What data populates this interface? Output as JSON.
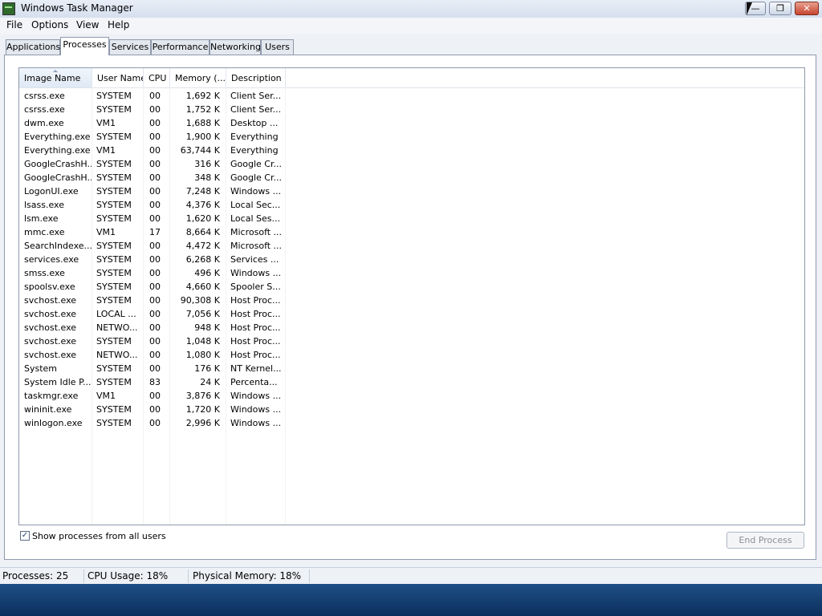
{
  "window": {
    "title": "Windows Task Manager"
  },
  "menu": [
    "File",
    "Options",
    "View",
    "Help"
  ],
  "tabs": [
    "Applications",
    "Processes",
    "Services",
    "Performance",
    "Networking",
    "Users"
  ],
  "active_tab": "Processes",
  "columns": [
    "Image Name",
    "User Name",
    "CPU",
    "Memory (...",
    "Description"
  ],
  "processes": [
    {
      "name": "csrss.exe",
      "user": "SYSTEM",
      "cpu": "00",
      "mem": "1,692 K",
      "desc": "Client Ser..."
    },
    {
      "name": "csrss.exe",
      "user": "SYSTEM",
      "cpu": "00",
      "mem": "1,752 K",
      "desc": "Client Ser..."
    },
    {
      "name": "dwm.exe",
      "user": "VM1",
      "cpu": "00",
      "mem": "1,688 K",
      "desc": "Desktop ..."
    },
    {
      "name": "Everything.exe",
      "user": "SYSTEM",
      "cpu": "00",
      "mem": "1,900 K",
      "desc": "Everything"
    },
    {
      "name": "Everything.exe",
      "user": "VM1",
      "cpu": "00",
      "mem": "63,744 K",
      "desc": "Everything"
    },
    {
      "name": "GoogleCrashH...",
      "user": "SYSTEM",
      "cpu": "00",
      "mem": "316 K",
      "desc": "Google Cr..."
    },
    {
      "name": "GoogleCrashH...",
      "user": "SYSTEM",
      "cpu": "00",
      "mem": "348 K",
      "desc": "Google Cr..."
    },
    {
      "name": "LogonUI.exe",
      "user": "SYSTEM",
      "cpu": "00",
      "mem": "7,248 K",
      "desc": "Windows ..."
    },
    {
      "name": "lsass.exe",
      "user": "SYSTEM",
      "cpu": "00",
      "mem": "4,376 K",
      "desc": "Local Sec..."
    },
    {
      "name": "lsm.exe",
      "user": "SYSTEM",
      "cpu": "00",
      "mem": "1,620 K",
      "desc": "Local Ses..."
    },
    {
      "name": "mmc.exe",
      "user": "VM1",
      "cpu": "17",
      "mem": "8,664 K",
      "desc": "Microsoft ..."
    },
    {
      "name": "SearchIndexe...",
      "user": "SYSTEM",
      "cpu": "00",
      "mem": "4,472 K",
      "desc": "Microsoft ..."
    },
    {
      "name": "services.exe",
      "user": "SYSTEM",
      "cpu": "00",
      "mem": "6,268 K",
      "desc": "Services ..."
    },
    {
      "name": "smss.exe",
      "user": "SYSTEM",
      "cpu": "00",
      "mem": "496 K",
      "desc": "Windows ..."
    },
    {
      "name": "spoolsv.exe",
      "user": "SYSTEM",
      "cpu": "00",
      "mem": "4,660 K",
      "desc": "Spooler S..."
    },
    {
      "name": "svchost.exe",
      "user": "SYSTEM",
      "cpu": "00",
      "mem": "90,308 K",
      "desc": "Host Proc..."
    },
    {
      "name": "svchost.exe",
      "user": "LOCAL ...",
      "cpu": "00",
      "mem": "7,056 K",
      "desc": "Host Proc..."
    },
    {
      "name": "svchost.exe",
      "user": "NETWO...",
      "cpu": "00",
      "mem": "948 K",
      "desc": "Host Proc..."
    },
    {
      "name": "svchost.exe",
      "user": "SYSTEM",
      "cpu": "00",
      "mem": "1,048 K",
      "desc": "Host Proc..."
    },
    {
      "name": "svchost.exe",
      "user": "NETWO...",
      "cpu": "00",
      "mem": "1,080 K",
      "desc": "Host Proc..."
    },
    {
      "name": "System",
      "user": "SYSTEM",
      "cpu": "00",
      "mem": "176 K",
      "desc": "NT Kernel..."
    },
    {
      "name": "System Idle P...",
      "user": "SYSTEM",
      "cpu": "83",
      "mem": "24 K",
      "desc": "Percenta..."
    },
    {
      "name": "taskmgr.exe",
      "user": "VM1",
      "cpu": "00",
      "mem": "3,876 K",
      "desc": "Windows ..."
    },
    {
      "name": "wininit.exe",
      "user": "SYSTEM",
      "cpu": "00",
      "mem": "1,720 K",
      "desc": "Windows ..."
    },
    {
      "name": "winlogon.exe",
      "user": "SYSTEM",
      "cpu": "00",
      "mem": "2,996 K",
      "desc": "Windows ..."
    }
  ],
  "show_all_users": {
    "label": "Show processes from all users",
    "checked": true
  },
  "end_process_label": "End Process",
  "status": {
    "processes": "Processes: 25",
    "cpu": "CPU Usage: 18%",
    "memory": "Physical Memory: 18%"
  },
  "icons": {
    "app": "task-manager-icon",
    "minimize": "minimize-icon",
    "maximize": "restore-icon",
    "close": "close-icon",
    "check": "checkmark-icon"
  }
}
